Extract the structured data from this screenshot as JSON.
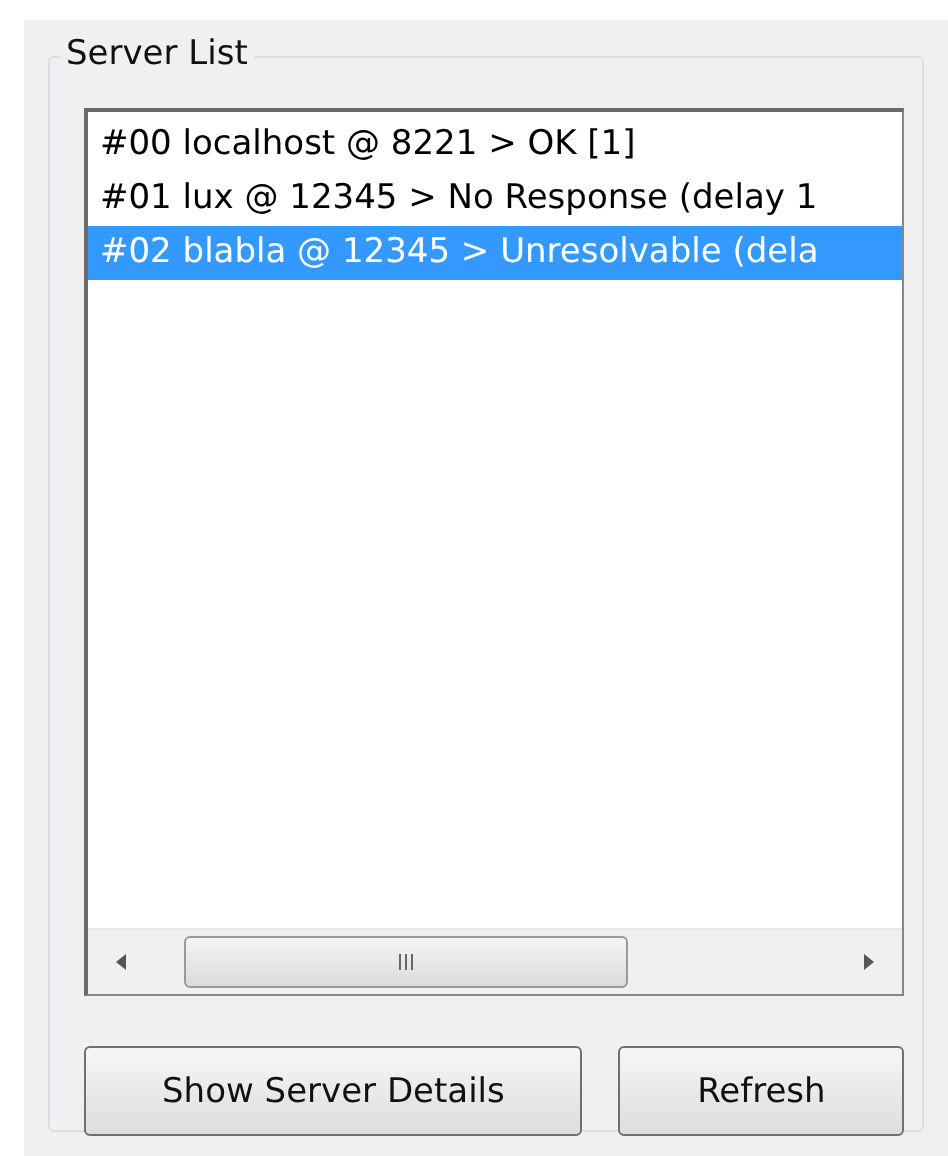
{
  "group": {
    "title": "Server List"
  },
  "servers": [
    {
      "label": "#00 localhost @ 8221 > OK [1]",
      "selected": false
    },
    {
      "label": "#01 lux @ 12345 > No Response (delay 1",
      "selected": false
    },
    {
      "label": "#02 blabla @ 12345 > Unresolvable (dela",
      "selected": true
    }
  ],
  "buttons": [
    {
      "label": "Show Server Details"
    },
    {
      "label": "Refresh"
    }
  ]
}
